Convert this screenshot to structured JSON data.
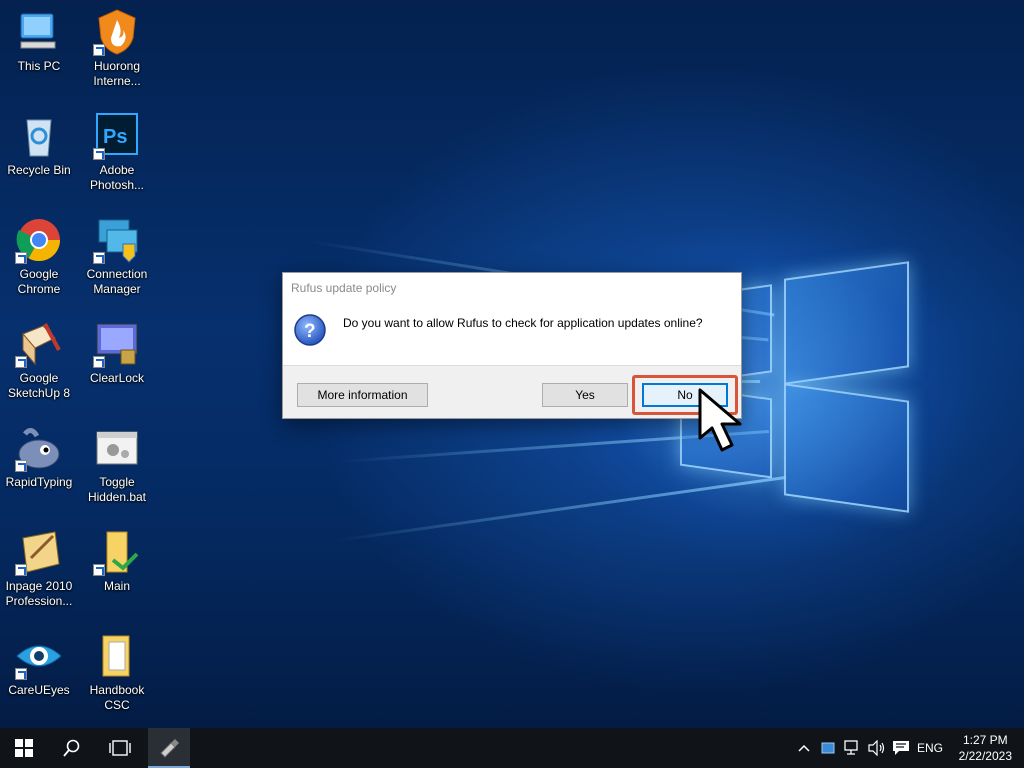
{
  "desktop": {
    "icons": [
      {
        "label_line1": "This PC",
        "label_line2": "",
        "icon": "this-pc-icon"
      },
      {
        "label_line1": "Huorong",
        "label_line2": "Interne...",
        "icon": "huorong-icon"
      },
      {
        "label_line1": "Recycle Bin",
        "label_line2": "",
        "icon": "recycle-bin-icon"
      },
      {
        "label_line1": "Adobe",
        "label_line2": "Photosh...",
        "icon": "photoshop-icon"
      },
      {
        "label_line1": "Google",
        "label_line2": "Chrome",
        "icon": "chrome-icon"
      },
      {
        "label_line1": "Connection",
        "label_line2": "Manager",
        "icon": "connection-manager-icon"
      },
      {
        "label_line1": "Google",
        "label_line2": "SketchUp 8",
        "icon": "sketchup-icon"
      },
      {
        "label_line1": "ClearLock",
        "label_line2": "",
        "icon": "clearlock-icon"
      },
      {
        "label_line1": "RapidTyping",
        "label_line2": "",
        "icon": "rapidtyping-icon"
      },
      {
        "label_line1": "Toggle",
        "label_line2": "Hidden.bat",
        "icon": "batch-file-icon"
      },
      {
        "label_line1": "Inpage 2010",
        "label_line2": "Profession...",
        "icon": "inpage-icon"
      },
      {
        "label_line1": "Main",
        "label_line2": "",
        "icon": "folder-shortcut-icon"
      },
      {
        "label_line1": "CareUEyes",
        "label_line2": "",
        "icon": "careueyes-icon"
      },
      {
        "label_line1": "Handbook",
        "label_line2": "CSC",
        "icon": "folder-icon"
      }
    ]
  },
  "dialog": {
    "title": "Rufus update policy",
    "message": "Do you want to allow Rufus to check for application updates online?",
    "icon": "question-icon",
    "buttons": {
      "more_info": "More information",
      "yes": "Yes",
      "no": "No"
    }
  },
  "taskbar": {
    "language": "ENG",
    "time": "1:27 PM",
    "date": "2/22/2023"
  },
  "colors": {
    "highlight": "#d9553a",
    "accent": "#0078d7",
    "taskbar": "#101418"
  }
}
